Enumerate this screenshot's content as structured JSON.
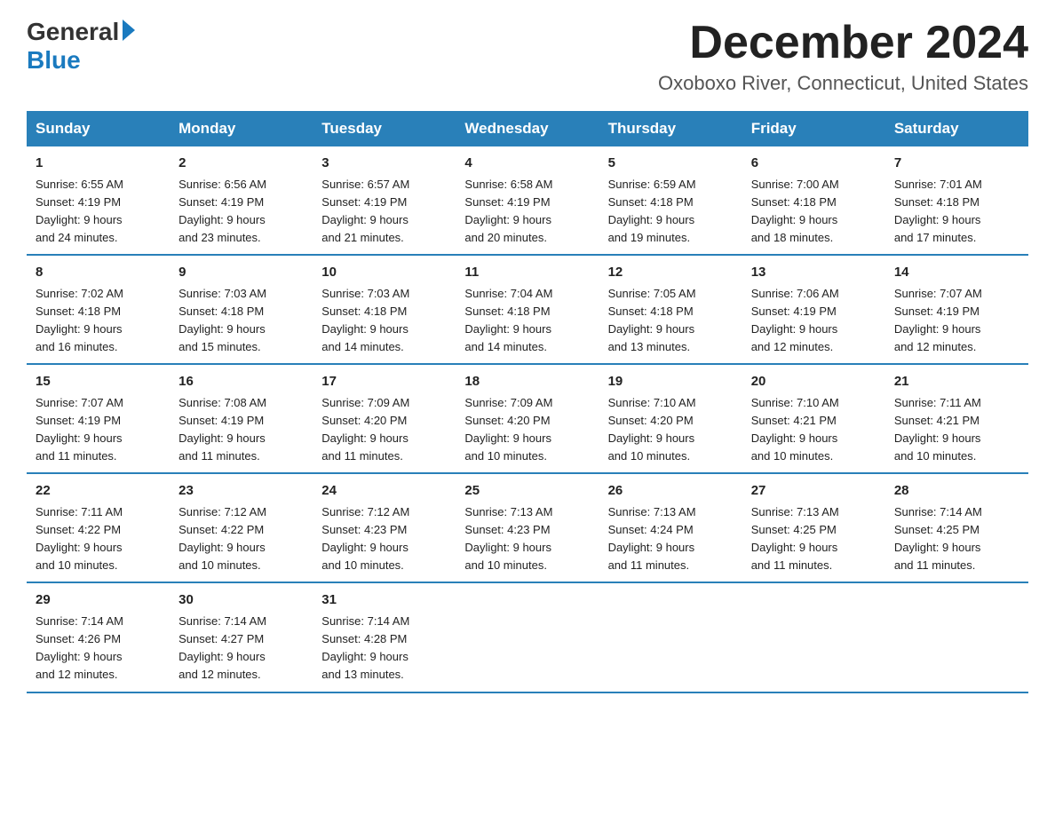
{
  "header": {
    "logo_general": "General",
    "logo_blue": "Blue",
    "month_title": "December 2024",
    "location": "Oxoboxo River, Connecticut, United States"
  },
  "days_of_week": [
    "Sunday",
    "Monday",
    "Tuesday",
    "Wednesday",
    "Thursday",
    "Friday",
    "Saturday"
  ],
  "weeks": [
    [
      {
        "day": "1",
        "info": "Sunrise: 6:55 AM\nSunset: 4:19 PM\nDaylight: 9 hours\nand 24 minutes."
      },
      {
        "day": "2",
        "info": "Sunrise: 6:56 AM\nSunset: 4:19 PM\nDaylight: 9 hours\nand 23 minutes."
      },
      {
        "day": "3",
        "info": "Sunrise: 6:57 AM\nSunset: 4:19 PM\nDaylight: 9 hours\nand 21 minutes."
      },
      {
        "day": "4",
        "info": "Sunrise: 6:58 AM\nSunset: 4:19 PM\nDaylight: 9 hours\nand 20 minutes."
      },
      {
        "day": "5",
        "info": "Sunrise: 6:59 AM\nSunset: 4:18 PM\nDaylight: 9 hours\nand 19 minutes."
      },
      {
        "day": "6",
        "info": "Sunrise: 7:00 AM\nSunset: 4:18 PM\nDaylight: 9 hours\nand 18 minutes."
      },
      {
        "day": "7",
        "info": "Sunrise: 7:01 AM\nSunset: 4:18 PM\nDaylight: 9 hours\nand 17 minutes."
      }
    ],
    [
      {
        "day": "8",
        "info": "Sunrise: 7:02 AM\nSunset: 4:18 PM\nDaylight: 9 hours\nand 16 minutes."
      },
      {
        "day": "9",
        "info": "Sunrise: 7:03 AM\nSunset: 4:18 PM\nDaylight: 9 hours\nand 15 minutes."
      },
      {
        "day": "10",
        "info": "Sunrise: 7:03 AM\nSunset: 4:18 PM\nDaylight: 9 hours\nand 14 minutes."
      },
      {
        "day": "11",
        "info": "Sunrise: 7:04 AM\nSunset: 4:18 PM\nDaylight: 9 hours\nand 14 minutes."
      },
      {
        "day": "12",
        "info": "Sunrise: 7:05 AM\nSunset: 4:18 PM\nDaylight: 9 hours\nand 13 minutes."
      },
      {
        "day": "13",
        "info": "Sunrise: 7:06 AM\nSunset: 4:19 PM\nDaylight: 9 hours\nand 12 minutes."
      },
      {
        "day": "14",
        "info": "Sunrise: 7:07 AM\nSunset: 4:19 PM\nDaylight: 9 hours\nand 12 minutes."
      }
    ],
    [
      {
        "day": "15",
        "info": "Sunrise: 7:07 AM\nSunset: 4:19 PM\nDaylight: 9 hours\nand 11 minutes."
      },
      {
        "day": "16",
        "info": "Sunrise: 7:08 AM\nSunset: 4:19 PM\nDaylight: 9 hours\nand 11 minutes."
      },
      {
        "day": "17",
        "info": "Sunrise: 7:09 AM\nSunset: 4:20 PM\nDaylight: 9 hours\nand 11 minutes."
      },
      {
        "day": "18",
        "info": "Sunrise: 7:09 AM\nSunset: 4:20 PM\nDaylight: 9 hours\nand 10 minutes."
      },
      {
        "day": "19",
        "info": "Sunrise: 7:10 AM\nSunset: 4:20 PM\nDaylight: 9 hours\nand 10 minutes."
      },
      {
        "day": "20",
        "info": "Sunrise: 7:10 AM\nSunset: 4:21 PM\nDaylight: 9 hours\nand 10 minutes."
      },
      {
        "day": "21",
        "info": "Sunrise: 7:11 AM\nSunset: 4:21 PM\nDaylight: 9 hours\nand 10 minutes."
      }
    ],
    [
      {
        "day": "22",
        "info": "Sunrise: 7:11 AM\nSunset: 4:22 PM\nDaylight: 9 hours\nand 10 minutes."
      },
      {
        "day": "23",
        "info": "Sunrise: 7:12 AM\nSunset: 4:22 PM\nDaylight: 9 hours\nand 10 minutes."
      },
      {
        "day": "24",
        "info": "Sunrise: 7:12 AM\nSunset: 4:23 PM\nDaylight: 9 hours\nand 10 minutes."
      },
      {
        "day": "25",
        "info": "Sunrise: 7:13 AM\nSunset: 4:23 PM\nDaylight: 9 hours\nand 10 minutes."
      },
      {
        "day": "26",
        "info": "Sunrise: 7:13 AM\nSunset: 4:24 PM\nDaylight: 9 hours\nand 11 minutes."
      },
      {
        "day": "27",
        "info": "Sunrise: 7:13 AM\nSunset: 4:25 PM\nDaylight: 9 hours\nand 11 minutes."
      },
      {
        "day": "28",
        "info": "Sunrise: 7:14 AM\nSunset: 4:25 PM\nDaylight: 9 hours\nand 11 minutes."
      }
    ],
    [
      {
        "day": "29",
        "info": "Sunrise: 7:14 AM\nSunset: 4:26 PM\nDaylight: 9 hours\nand 12 minutes."
      },
      {
        "day": "30",
        "info": "Sunrise: 7:14 AM\nSunset: 4:27 PM\nDaylight: 9 hours\nand 12 minutes."
      },
      {
        "day": "31",
        "info": "Sunrise: 7:14 AM\nSunset: 4:28 PM\nDaylight: 9 hours\nand 13 minutes."
      },
      {
        "day": "",
        "info": ""
      },
      {
        "day": "",
        "info": ""
      },
      {
        "day": "",
        "info": ""
      },
      {
        "day": "",
        "info": ""
      }
    ]
  ]
}
